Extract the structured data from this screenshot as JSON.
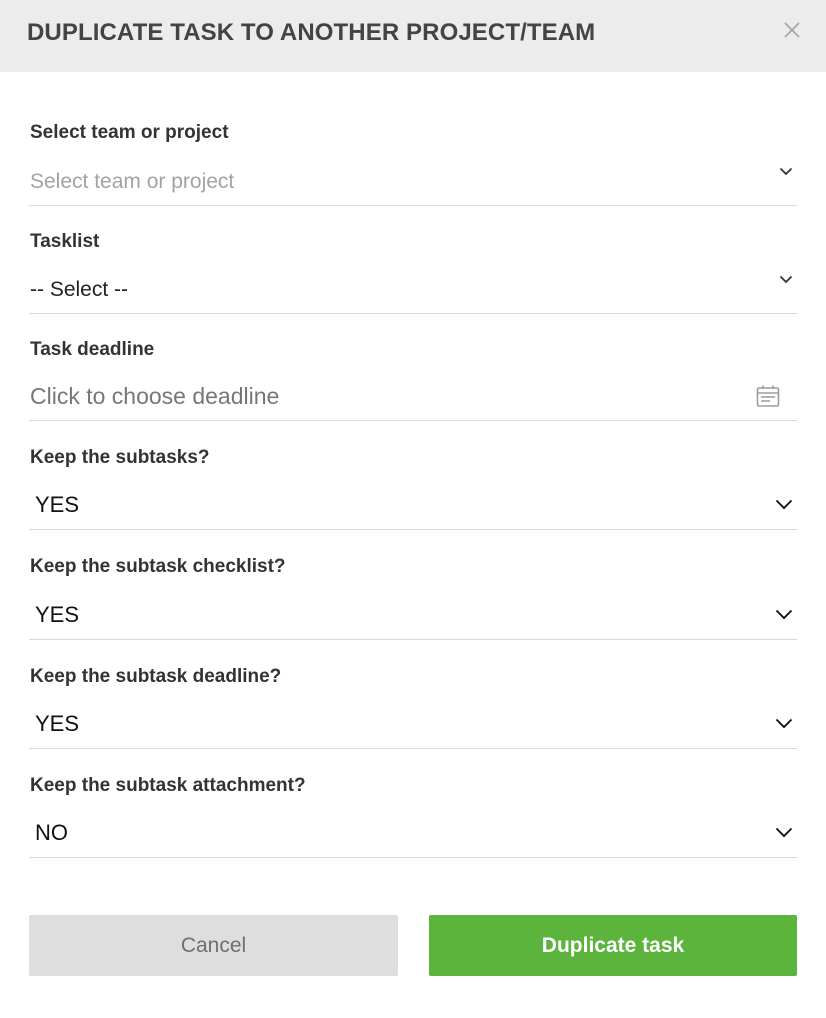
{
  "dialog": {
    "title": "DUPLICATE TASK TO ANOTHER PROJECT/TEAM",
    "close_icon": "close-icon"
  },
  "fields": {
    "team_project": {
      "label": "Select team or project",
      "placeholder": "Select team or project",
      "icon": "chevron-down-icon"
    },
    "tasklist": {
      "label": "Tasklist",
      "value": "-- Select --",
      "icon": "chevron-down-icon"
    },
    "deadline": {
      "label": "Task deadline",
      "placeholder": "Click to choose deadline",
      "icon": "calendar-icon"
    },
    "keep_subtasks": {
      "label": "Keep the subtasks?",
      "value": "YES",
      "icon": "chevron-down-icon"
    },
    "keep_checklist": {
      "label": "Keep the subtask checklist?",
      "value": "YES",
      "icon": "chevron-down-icon"
    },
    "keep_deadline": {
      "label": "Keep the subtask deadline?",
      "value": "YES",
      "icon": "chevron-down-icon"
    },
    "keep_attachment": {
      "label": "Keep the subtask attachment?",
      "value": "NO",
      "icon": "chevron-down-icon"
    }
  },
  "buttons": {
    "cancel": "Cancel",
    "duplicate": "Duplicate task"
  },
  "colors": {
    "header_bg": "#ececec",
    "primary": "#5db43c",
    "cancel_bg": "#dedede"
  }
}
